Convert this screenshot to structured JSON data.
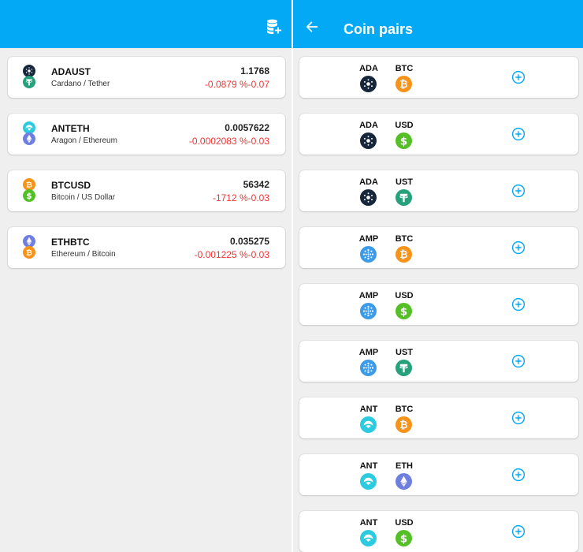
{
  "left_panel": {
    "header": {
      "icon": "database-add-icon"
    },
    "tickers": [
      {
        "symbol": "ADAUST",
        "name": "Cardano / Tether",
        "price": "1.1768",
        "change": "-0.0879 %-0.07",
        "icons": [
          "cardano-icon",
          "tether-icon"
        ]
      },
      {
        "symbol": "ANTETH",
        "name": "Aragon / Ethereum",
        "price": "0.0057622",
        "change": "-0.0002083 %-0.03",
        "icons": [
          "aragon-icon",
          "ethereum-icon"
        ]
      },
      {
        "symbol": "BTCUSD",
        "name": "Bitcoin / US Dollar",
        "price": "56342",
        "change": "-1712 %-0.03",
        "icons": [
          "bitcoin-icon",
          "dollar-icon"
        ]
      },
      {
        "symbol": "ETHBTC",
        "name": "Ethereum / Bitcoin",
        "price": "0.035275",
        "change": "-0.001225 %-0.03",
        "icons": [
          "ethereum-icon",
          "bitcoin-icon"
        ]
      }
    ]
  },
  "right_panel": {
    "header": {
      "title": "Coin pairs",
      "back_icon": "arrow-left-icon"
    },
    "pairs": [
      {
        "base": "ADA",
        "quote": "BTC",
        "icons": [
          "cardano-icon",
          "bitcoin-icon"
        ]
      },
      {
        "base": "ADA",
        "quote": "USD",
        "icons": [
          "cardano-icon",
          "dollar-icon"
        ]
      },
      {
        "base": "ADA",
        "quote": "UST",
        "icons": [
          "cardano-icon",
          "tether-icon"
        ]
      },
      {
        "base": "AMP",
        "quote": "BTC",
        "icons": [
          "amp-icon",
          "bitcoin-icon"
        ]
      },
      {
        "base": "AMP",
        "quote": "USD",
        "icons": [
          "amp-icon",
          "dollar-icon"
        ]
      },
      {
        "base": "AMP",
        "quote": "UST",
        "icons": [
          "amp-icon",
          "tether-icon"
        ]
      },
      {
        "base": "ANT",
        "quote": "BTC",
        "icons": [
          "aragon-icon",
          "bitcoin-icon"
        ]
      },
      {
        "base": "ANT",
        "quote": "ETH",
        "icons": [
          "aragon-icon",
          "ethereum-icon"
        ]
      },
      {
        "base": "ANT",
        "quote": "USD",
        "icons": [
          "aragon-icon",
          "dollar-icon"
        ]
      }
    ],
    "add_icon": "add-circle-icon"
  },
  "colors": {
    "appbar": "#03A9F4",
    "negative": "#f03434",
    "cardano": "#17273b",
    "tether": "#26a17b",
    "bitcoin": "#f7931a",
    "dollar": "#55c025",
    "ethereum": "#6f7fe0",
    "aragon": "#2ccbe0",
    "amp": "#3b9be8"
  }
}
